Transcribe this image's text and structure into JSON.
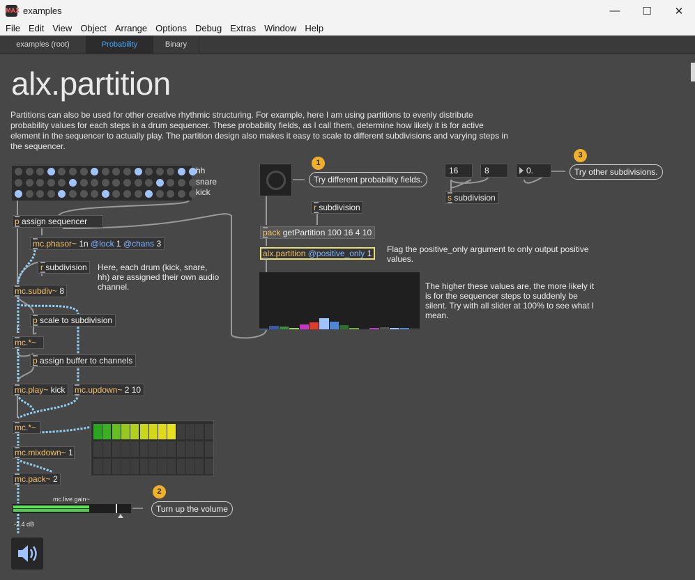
{
  "window": {
    "title": "examples",
    "logo": "MAX"
  },
  "window_controls": {
    "minimize": "—",
    "maximize": "☐",
    "close": "✕"
  },
  "menu": [
    "File",
    "Edit",
    "View",
    "Object",
    "Arrange",
    "Options",
    "Debug",
    "Extras",
    "Window",
    "Help"
  ],
  "tabs": [
    {
      "label": "examples (root)",
      "active": false
    },
    {
      "label": "Probability",
      "active": true
    },
    {
      "label": "Binary",
      "active": false
    }
  ],
  "patch": {
    "heading": "alx.partition",
    "intro": "Partitions can also be used for other creative rhythmic structuring. For example, here I am using partitions to evenly distribute probability values for each steps in a drum sequencer. These probability fields, as I call them, determine how likely it is for active element in the sequencer to actually play. The partition design also makes it easy to scale to different subdivisions and varying steps in the sequencer.",
    "sequencer": {
      "labels": [
        "hh",
        "snare",
        "kick"
      ],
      "rows": [
        [
          0,
          0,
          0,
          1,
          0,
          0,
          0,
          1,
          0,
          0,
          0,
          1,
          0,
          0,
          0,
          1,
          1
        ],
        [
          0,
          0,
          0,
          0,
          0,
          1,
          0,
          0,
          0,
          0,
          0,
          0,
          0,
          1,
          0,
          0,
          0
        ],
        [
          1,
          0,
          0,
          0,
          1,
          0,
          0,
          0,
          1,
          0,
          0,
          0,
          1,
          0,
          0,
          0,
          0
        ]
      ],
      "colors": {
        "on": "#9ec3ff",
        "off": "#555555"
      }
    },
    "objects": {
      "assign_seq": {
        "k": "p",
        "rest": " assign sequencer"
      },
      "phasor": {
        "k": "mc.phasor~",
        "rest": " 1n ",
        "a1": "@lock",
        "v1": " 1 ",
        "a2": "@chans",
        "v2": " 3"
      },
      "r_sub_left": {
        "k": "r",
        "rest": " subdivision"
      },
      "subdiv": {
        "k": "mc.subdiv~",
        "rest": " 8"
      },
      "scale": {
        "k": "p",
        "rest": " scale to subdivision"
      },
      "mult1": {
        "k": "mc.*~",
        "rest": ""
      },
      "assign_buf": {
        "k": "p",
        "rest": " assign buffer to channels"
      },
      "play": {
        "k": "mc.play~",
        "rest": " kick"
      },
      "updown": {
        "k": "mc.updown~",
        "rest": " 2 10"
      },
      "mult2": {
        "k": "mc.*~",
        "rest": ""
      },
      "mixdown": {
        "k": "mc.mixdown~",
        "rest": " 1"
      },
      "mcpack": {
        "k": "mc.pack~",
        "rest": " 2"
      },
      "r_sub_right": {
        "k": "r",
        "rest": " subdivision"
      },
      "pack": {
        "k": "pack",
        "rest": " getPartition 100 16 4 10"
      },
      "partition": {
        "k": "alx.partition",
        "rest": " ",
        "a1": "@positive_only",
        "v1": " 1"
      },
      "s_sub": {
        "k": "s",
        "rest": " subdivision"
      }
    },
    "comments": {
      "drums": "Here, each drum (kick, snare, hh) are assigned their own audio channel.",
      "flag": "Flag the positive_only argument to only output positive values.",
      "higher": "The higher these values are, the more likely it is for the sequencer steps to suddenly be silent. Try with all slider at 100% to see what I mean."
    },
    "callouts": [
      {
        "badge": "1",
        "text": "Try different probability fields."
      },
      {
        "badge": "2",
        "text": "Turn up the volume"
      },
      {
        "badge": "3",
        "text": "Try other subdivisions."
      }
    ],
    "number_boxes": [
      "16",
      "8",
      "0."
    ],
    "probability_field": {
      "values": [
        0.0,
        0.06,
        0.05,
        0.03,
        0.09,
        0.12,
        0.19,
        0.13,
        0.07,
        0.02,
        0.03,
        0.02,
        0.04,
        0.02,
        0.03,
        0.02
      ],
      "colors": [
        "#4f86d6",
        "#3a5aa6",
        "#3d8c3d",
        "#9bd35a",
        "#c238c2",
        "#e23b2e",
        "#9ec3ff",
        "#4f86d6",
        "#2e6e2e",
        "#6fae3f",
        "#222222",
        "#c238c2",
        "#555555",
        "#9ec3ff",
        "#4f86d6",
        "#333333"
      ]
    },
    "meter": {
      "rows": 3,
      "cols": 13,
      "lit_cols": 9,
      "colors": [
        "#29a51e",
        "#39b121",
        "#63c020",
        "#98c81e",
        "#b3d11c",
        "#cad61a",
        "#d4d61c",
        "#e0db17",
        "#e6e120"
      ]
    },
    "gain": {
      "label": "mc.live.gain~",
      "readout": "-2.4 dB",
      "level": 0.65
    },
    "icons": {
      "speaker": "speaker-icon",
      "dial": "dial-icon",
      "triangle": "triangle-icon"
    }
  }
}
